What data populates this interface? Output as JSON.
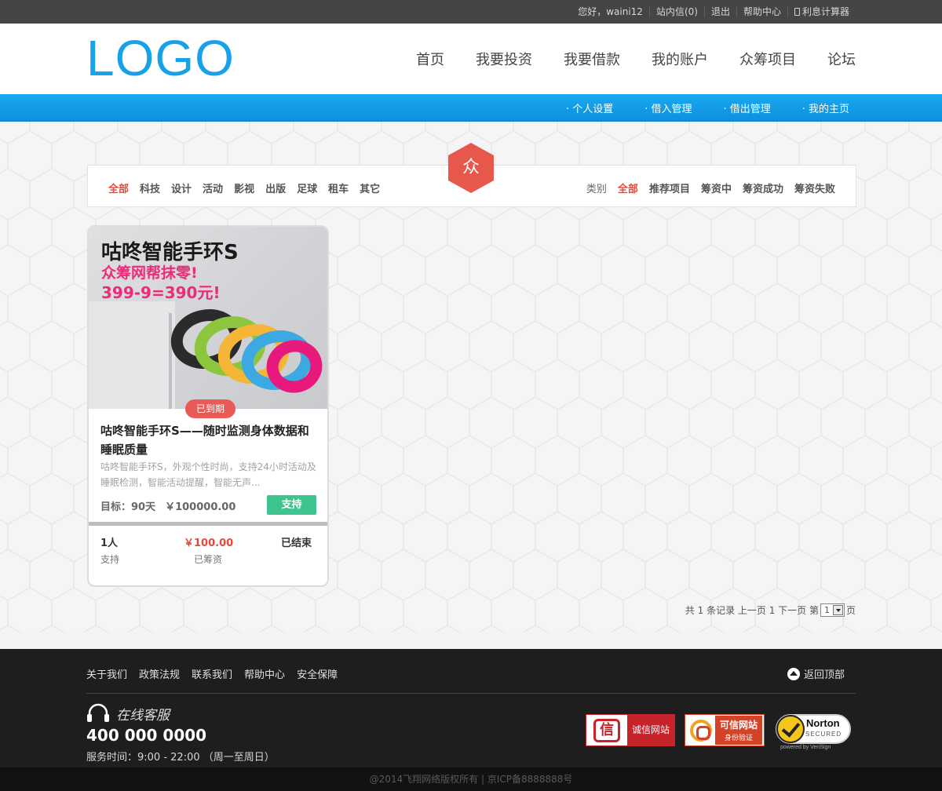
{
  "topbar": {
    "greeting": "您好，waini12",
    "messages": "站内信(0)",
    "logout": "退出",
    "help": "帮助中心",
    "calculator": "利息计算器"
  },
  "header": {
    "logo": "LOGO",
    "nav": [
      "首页",
      "我要投资",
      "我要借款",
      "我的账户",
      "众筹项目",
      "论坛"
    ]
  },
  "subnav": [
    "· 个人设置",
    "· 借入管理",
    "· 借出管理",
    "· 我的主页"
  ],
  "badge": {
    "char": "众",
    "color": "#e8574c"
  },
  "filters": {
    "categories": [
      "全部",
      "科技",
      "设计",
      "活动",
      "影视",
      "出版",
      "足球",
      "租车",
      "其它"
    ],
    "status_label": "类别",
    "statuses": [
      "全部",
      "推荐项目",
      "筹资中",
      "筹资成功",
      "筹资失败"
    ]
  },
  "project": {
    "image_title": "咕咚智能手环S",
    "image_line2": "众筹网帮抹零!",
    "image_line3": "399-9=390元!",
    "status_tag": "已到期",
    "title": "咕咚智能手环S——随时监测身体数据和睡眠质量",
    "description": "咕咚智能手环S，外观个性时尚，支持24小时活动及睡眠检测，智能活动提醒，智能无声...",
    "target_label": "目标：90天",
    "target_amount": "￥100000.00",
    "support_button": "支持",
    "supporters_value": "1人",
    "supporters_label": "支持",
    "raised_value": "￥100.00",
    "raised_label": "已筹资",
    "state_value": "已结束",
    "progress": 0.001
  },
  "pager": {
    "text_before": "共 1 条记录 上一页 1 下一页 第",
    "page_select": "1",
    "text_after": "页"
  },
  "footer": {
    "links": [
      "关于我们",
      "政策法规",
      "联系我们",
      "帮助中心",
      "安全保障"
    ],
    "back_to_top": "返回顶部",
    "service_title": "在线客服",
    "phone": "400 000 0000",
    "hours": "服务时间：9:00 - 22:00 （周一至周日）",
    "badge_integrity_icon": "信",
    "badge_integrity": "诚信网站",
    "badge_trusted_title": "可信网站",
    "badge_trusted_sub": "身份验证",
    "badge_norton": "Norton",
    "badge_norton_sub": "SECURED",
    "badge_norton_powered": "powered by VeriSign",
    "copyright": "@2014飞翔网络版权所有 | 京ICP备8888888号"
  },
  "colors": {
    "brand_blue": "#17a1e8",
    "accent_red": "#e9473a",
    "support_green": "#3ec48f"
  }
}
